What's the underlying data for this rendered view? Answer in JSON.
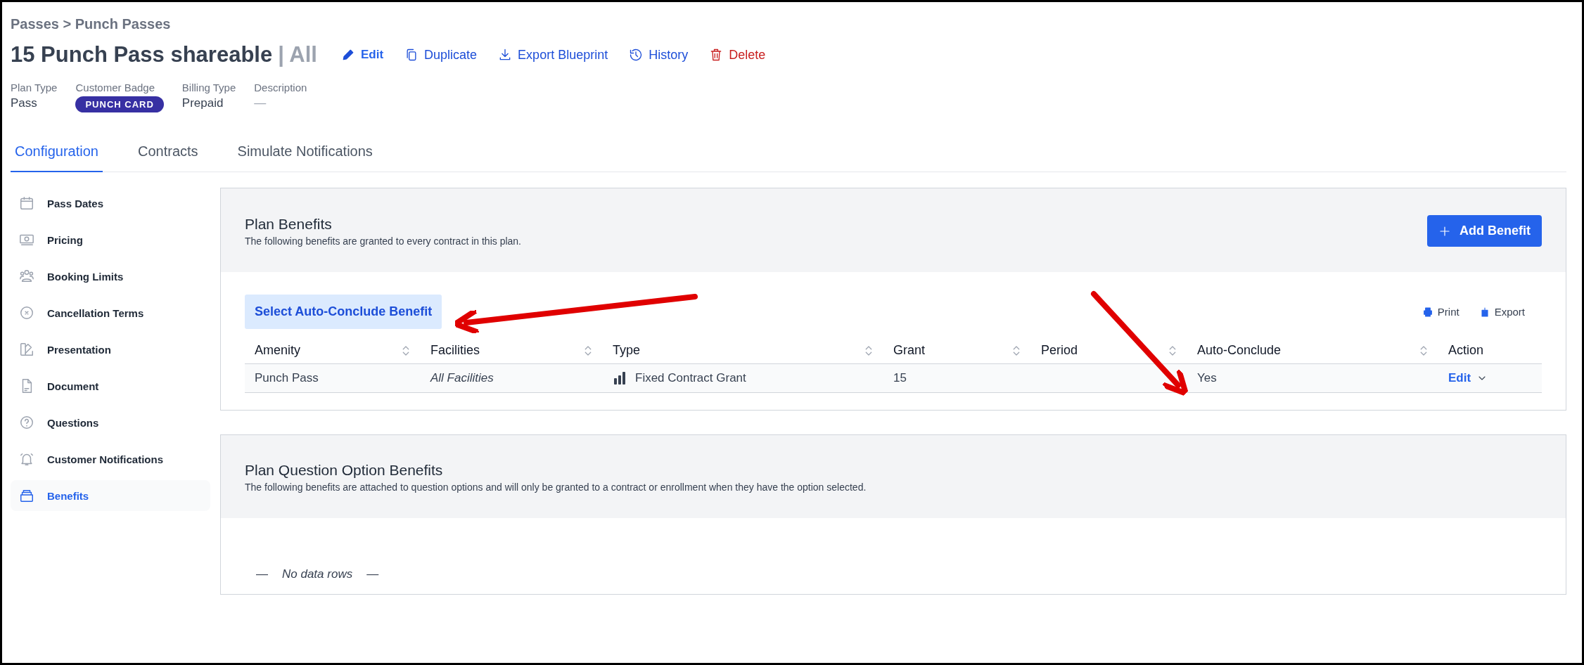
{
  "breadcrumb": "Passes > Punch Passes",
  "title": "15 Punch Pass shareable",
  "title_suffix": "| All",
  "actions": [
    {
      "label": "Edit",
      "kind": "edit"
    },
    {
      "label": "Duplicate",
      "kind": "duplicate"
    },
    {
      "label": "Export Blueprint",
      "kind": "export"
    },
    {
      "label": "History",
      "kind": "history"
    },
    {
      "label": "Delete",
      "kind": "delete"
    }
  ],
  "meta": [
    {
      "label": "Plan Type",
      "value": "Pass",
      "kind": "text"
    },
    {
      "label": "Customer Badge",
      "value": "PUNCH CARD",
      "kind": "badge"
    },
    {
      "label": "Billing Type",
      "value": "Prepaid",
      "kind": "text"
    },
    {
      "label": "Description",
      "value": "—",
      "kind": "empty"
    }
  ],
  "tabs": [
    {
      "label": "Configuration",
      "selected": true
    },
    {
      "label": "Contracts",
      "selected": false
    },
    {
      "label": "Simulate Notifications",
      "selected": false
    }
  ],
  "sidebar": {
    "items": [
      {
        "label": "Pass Dates",
        "selected": false
      },
      {
        "label": "Pricing",
        "selected": false
      },
      {
        "label": "Booking Limits",
        "selected": false
      },
      {
        "label": "Cancellation Terms",
        "selected": false
      },
      {
        "label": "Presentation",
        "selected": false
      },
      {
        "label": "Document",
        "selected": false
      },
      {
        "label": "Questions",
        "selected": false
      },
      {
        "label": "Customer Notifications",
        "selected": false
      },
      {
        "label": "Benefits",
        "selected": true
      }
    ]
  },
  "plan_benefits": {
    "title": "Plan Benefits",
    "subtitle": "The following benefits are granted to every contract in this plan.",
    "add_button": "Add Benefit",
    "select_button": "Select Auto-Conclude Benefit",
    "print": "Print",
    "export": "Export",
    "table": {
      "columns": [
        {
          "label": "Amenity",
          "sortable": true
        },
        {
          "label": "Facilities",
          "sortable": true
        },
        {
          "label": "Type",
          "sortable": true
        },
        {
          "label": "Grant",
          "sortable": true
        },
        {
          "label": "Period",
          "sortable": true
        },
        {
          "label": "Auto-Conclude",
          "sortable": true
        },
        {
          "label": "Action",
          "sortable": false
        }
      ],
      "rows": [
        {
          "amenity": "Punch Pass",
          "facilities": "All Facilities",
          "type": "Fixed Contract Grant",
          "grant": "15",
          "auto_conclude": "Yes",
          "action": "Edit"
        }
      ]
    }
  },
  "question_benefits": {
    "title": "Plan Question Option Benefits",
    "subtitle": "The following benefits are attached to question options and will only be granted to a contract or enrollment when they have the option selected.",
    "empty": [
      "—",
      "No data rows",
      "—"
    ]
  }
}
